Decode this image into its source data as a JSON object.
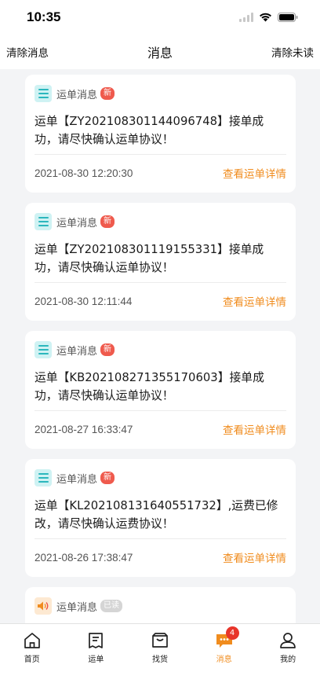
{
  "status_bar": {
    "time": "10:35"
  },
  "header": {
    "left_action": "清除消息",
    "title": "消息",
    "right_action": "清除未读"
  },
  "messages": [
    {
      "type": "运单消息",
      "badge": "新",
      "icon": "list-icon",
      "content": "运单【ZY202108301144096748】接单成功，请尽快确认运单协议！",
      "time": "2021-08-30 12:20:30",
      "link": "查看运单详情"
    },
    {
      "type": "运单消息",
      "badge": "新",
      "icon": "list-icon",
      "content": "运单【ZY202108301119155331】接单成功，请尽快确认运单协议！",
      "time": "2021-08-30 12:11:44",
      "link": "查看运单详情"
    },
    {
      "type": "运单消息",
      "badge": "新",
      "icon": "list-icon",
      "content": "运单【KB202108271355170603】接单成功，请尽快确认运单协议！",
      "time": "2021-08-27 16:33:47",
      "link": "查看运单详情"
    },
    {
      "type": "运单消息",
      "badge": "新",
      "icon": "list-icon",
      "content": "运单【KL202108131640551732】,运费已修改，请尽快确认运费协议！",
      "time": "2021-08-26 17:38:47",
      "link": "查看运单详情"
    },
    {
      "type": "运单消息",
      "badge": "已读",
      "icon": "speaker-icon"
    }
  ],
  "tabbar": {
    "items": [
      {
        "label": "首页",
        "icon": "home-icon"
      },
      {
        "label": "运单",
        "icon": "waybill-icon"
      },
      {
        "label": "找货",
        "icon": "box-icon"
      },
      {
        "label": "消息",
        "icon": "message-icon",
        "badge": "4",
        "active": true
      },
      {
        "label": "我的",
        "icon": "user-icon"
      }
    ]
  },
  "colors": {
    "accent": "#f08c1e",
    "new_badge": "#ef5a4d",
    "read_badge": "#d5d5d5",
    "tab_badge": "#e8352a",
    "icon_teal": "#2bb7bd"
  }
}
